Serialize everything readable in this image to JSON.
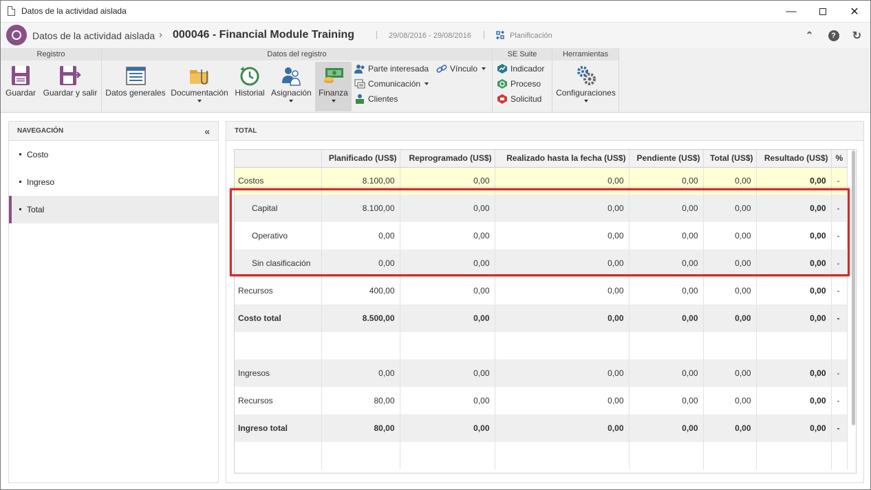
{
  "window": {
    "title": "Datos de la actividad aislada"
  },
  "header": {
    "breadcrumb": "Datos de la actividad aislada",
    "record": "000046 - Financial Module Training",
    "dates": "29/08/2016 - 29/08/2016",
    "status": "Planificación"
  },
  "ribbon": {
    "groups": {
      "registro": "Registro",
      "datos": "Datos del registro",
      "suite": "SE Suite",
      "herramientas": "Herramientas"
    },
    "guardar": "Guardar",
    "guardar_salir": "Guardar y salir",
    "datos_generales": "Datos generales",
    "documentacion": "Documentación",
    "historial": "Historial",
    "asignacion": "Asignación",
    "finanza": "Finanza",
    "parte_interesada": "Parte interesada",
    "comunicacion": "Comunicación",
    "clientes": "Clientes",
    "vinculo": "Vínculo",
    "indicador": "Indicador",
    "proceso": "Proceso",
    "solicitud": "Solicitud",
    "configuraciones": "Configuraciones"
  },
  "nav": {
    "title": "NAVEGACIÓN",
    "items": [
      "Costo",
      "Ingreso",
      "Total"
    ],
    "active": "Total"
  },
  "main": {
    "title": "TOTAL",
    "columns": [
      "",
      "Planificado (US$)",
      "Reprogramado (US$)",
      "Realizado hasta la fecha (US$)",
      "Pendiente (US$)",
      "Total (US$)",
      "Resultado (US$)",
      "%"
    ],
    "rows": [
      {
        "label": "Costos",
        "cells": [
          "8.100,00",
          "0,00",
          "0,00",
          "0,00",
          "0,00",
          "0,00",
          "-"
        ]
      },
      {
        "label": "Capital",
        "cells": [
          "8.100,00",
          "0,00",
          "0,00",
          "0,00",
          "0,00",
          "0,00",
          "-"
        ]
      },
      {
        "label": "Operativo",
        "cells": [
          "0,00",
          "0,00",
          "0,00",
          "0,00",
          "0,00",
          "0,00",
          "-"
        ]
      },
      {
        "label": "Sin clasificación",
        "cells": [
          "0,00",
          "0,00",
          "0,00",
          "0,00",
          "0,00",
          "0,00",
          "-"
        ]
      },
      {
        "label": "Recursos",
        "cells": [
          "400,00",
          "0,00",
          "0,00",
          "0,00",
          "0,00",
          "0,00",
          "-"
        ]
      },
      {
        "label": "Costo total",
        "cells": [
          "8.500,00",
          "0,00",
          "0,00",
          "0,00",
          "0,00",
          "0,00",
          "-"
        ]
      },
      {
        "label": "",
        "cells": [
          "",
          "",
          "",
          "",
          "",
          "",
          ""
        ]
      },
      {
        "label": "Ingresos",
        "cells": [
          "0,00",
          "0,00",
          "0,00",
          "0,00",
          "0,00",
          "0,00",
          "-"
        ]
      },
      {
        "label": "Recursos",
        "cells": [
          "80,00",
          "0,00",
          "0,00",
          "0,00",
          "0,00",
          "0,00",
          "-"
        ]
      },
      {
        "label": "Ingreso total",
        "cells": [
          "80,00",
          "0,00",
          "0,00",
          "0,00",
          "0,00",
          "0,00",
          "-"
        ]
      },
      {
        "label": "",
        "cells": [
          "",
          "",
          "",
          "",
          "",
          "",
          ""
        ]
      }
    ]
  },
  "colors": {
    "accent": "#8a4f86",
    "highlight": "#d42a2a",
    "yellow_row": "#ffffd6"
  }
}
